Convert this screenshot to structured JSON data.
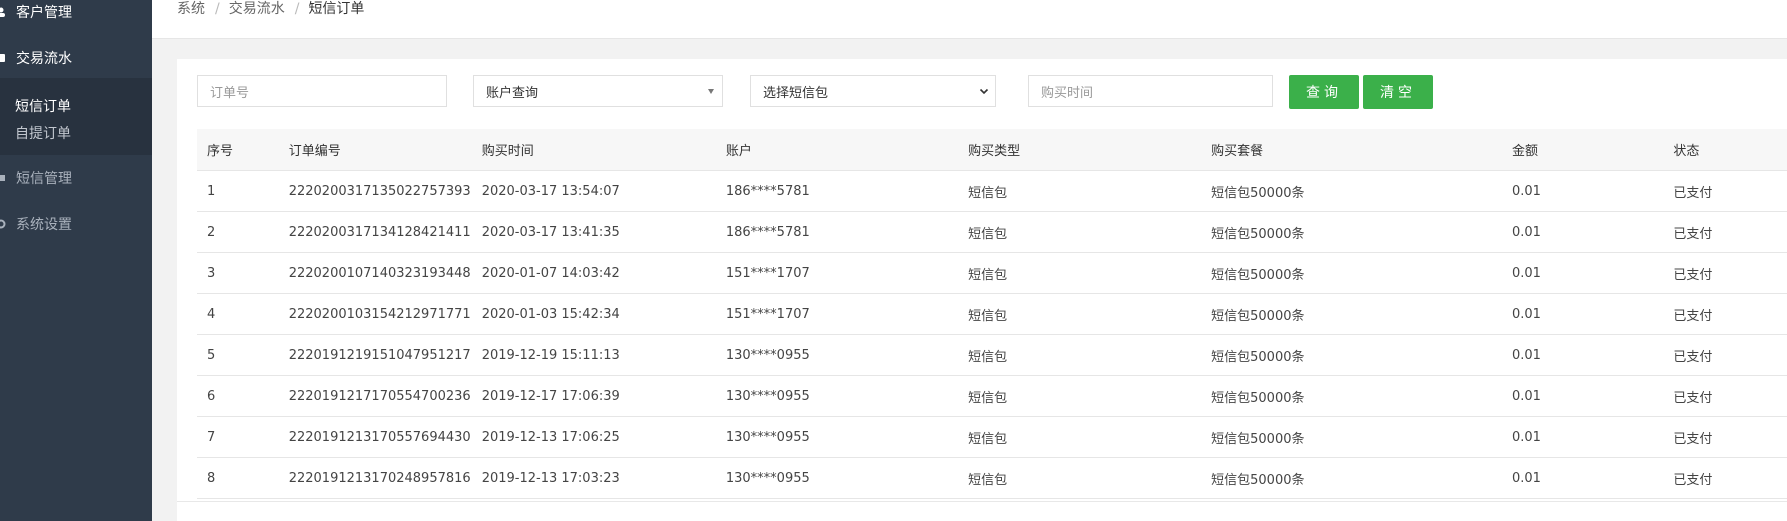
{
  "sidebar": {
    "customer_mgmt": "客户管理",
    "transactions": "交易流水",
    "sub_items": [
      "短信订单",
      "自提订单"
    ],
    "sms_mgmt": "短信管理",
    "system_settings": "系统设置"
  },
  "breadcrumb": [
    "系统",
    "交易流水",
    "短信订单"
  ],
  "filters": {
    "order_no_placeholder": "订单号",
    "account_select": "账户查询",
    "package_select": "选择短信包",
    "time_placeholder": "购买时间",
    "query_label": "查询",
    "clear_label": "清空"
  },
  "table": {
    "headers": [
      "序号",
      "订单编号",
      "购买时间",
      "账户",
      "购买类型",
      "购买套餐",
      "金额",
      "状态"
    ],
    "rows": [
      [
        "1",
        "222020031713502275739​3",
        "2020-03-17 13:54:07",
        "186****5781",
        "短信包",
        "短信包50000条",
        "0.01",
        "已支付"
      ],
      [
        "2",
        "2220200317134128421411",
        "2020-03-17 13:41:35",
        "186****5781",
        "短信包",
        "短信包50000条",
        "0.01",
        "已支付"
      ],
      [
        "3",
        "2220200107140323193448",
        "2020-01-07 14:03:42",
        "151****1707",
        "短信包",
        "短信包50000条",
        "0.01",
        "已支付"
      ],
      [
        "4",
        "2220200103154212971771",
        "2020-01-03 15:42:34",
        "151****1707",
        "短信包",
        "短信包50000条",
        "0.01",
        "已支付"
      ],
      [
        "5",
        "2220191219151047951217",
        "2019-12-19 15:11:13",
        "130****0955",
        "短信包",
        "短信包50000条",
        "0.01",
        "已支付"
      ],
      [
        "6",
        "2220191217170554700236",
        "2019-12-17 17:06:39",
        "130****0955",
        "短信包",
        "短信包50000条",
        "0.01",
        "已支付"
      ],
      [
        "7",
        "2220191213170557694430",
        "2019-12-13 17:06:25",
        "130****0955",
        "短信包",
        "短信包50000条",
        "0.01",
        "已支付"
      ],
      [
        "8",
        "2220191213170248957816",
        "2019-12-13 17:03:23",
        "130****0955",
        "短信包",
        "短信包50000条",
        "0.01",
        "已支付"
      ]
    ]
  },
  "colors": {
    "sidebar_bg": "#2f3b4a",
    "sidebar_sub_bg": "#28323f",
    "accent_green": "#3bb04a"
  }
}
